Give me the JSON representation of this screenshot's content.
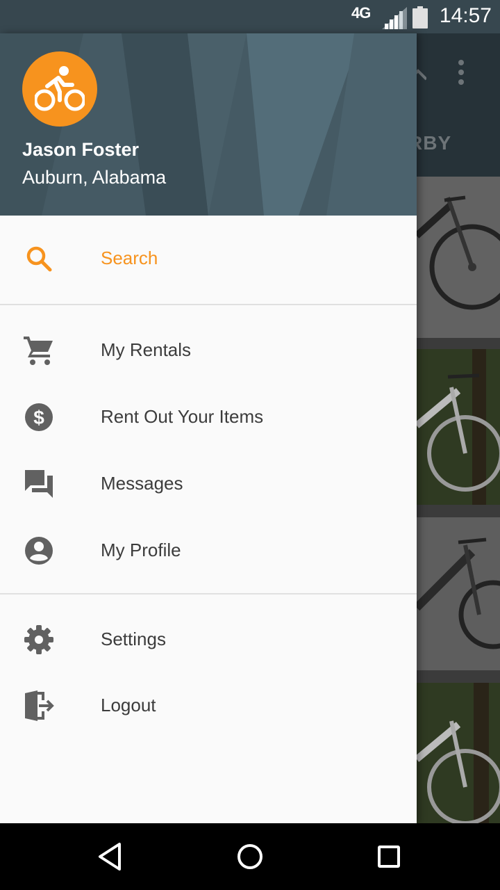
{
  "status_bar": {
    "network": "4G",
    "time": "14:57"
  },
  "background_screen": {
    "tab_text": "RBY"
  },
  "drawer": {
    "user": {
      "name": "Jason Foster",
      "location": "Auburn, Alabama",
      "avatar_icon": "bicycle-icon",
      "avatar_color": "#f7931e"
    },
    "items": [
      {
        "label": "Search",
        "icon": "search-icon",
        "active": true
      },
      {
        "label": "My Rentals",
        "icon": "cart-icon"
      },
      {
        "label": "Rent Out Your Items",
        "icon": "dollar-icon"
      },
      {
        "label": "Messages",
        "icon": "chat-icon"
      },
      {
        "label": "My Profile",
        "icon": "account-icon"
      },
      {
        "label": "Settings",
        "icon": "gear-icon"
      },
      {
        "label": "Logout",
        "icon": "logout-icon"
      }
    ]
  },
  "colors": {
    "accent": "#f7931e",
    "header": "#455a64",
    "text": "#3c3c3c",
    "icon": "#616161"
  }
}
